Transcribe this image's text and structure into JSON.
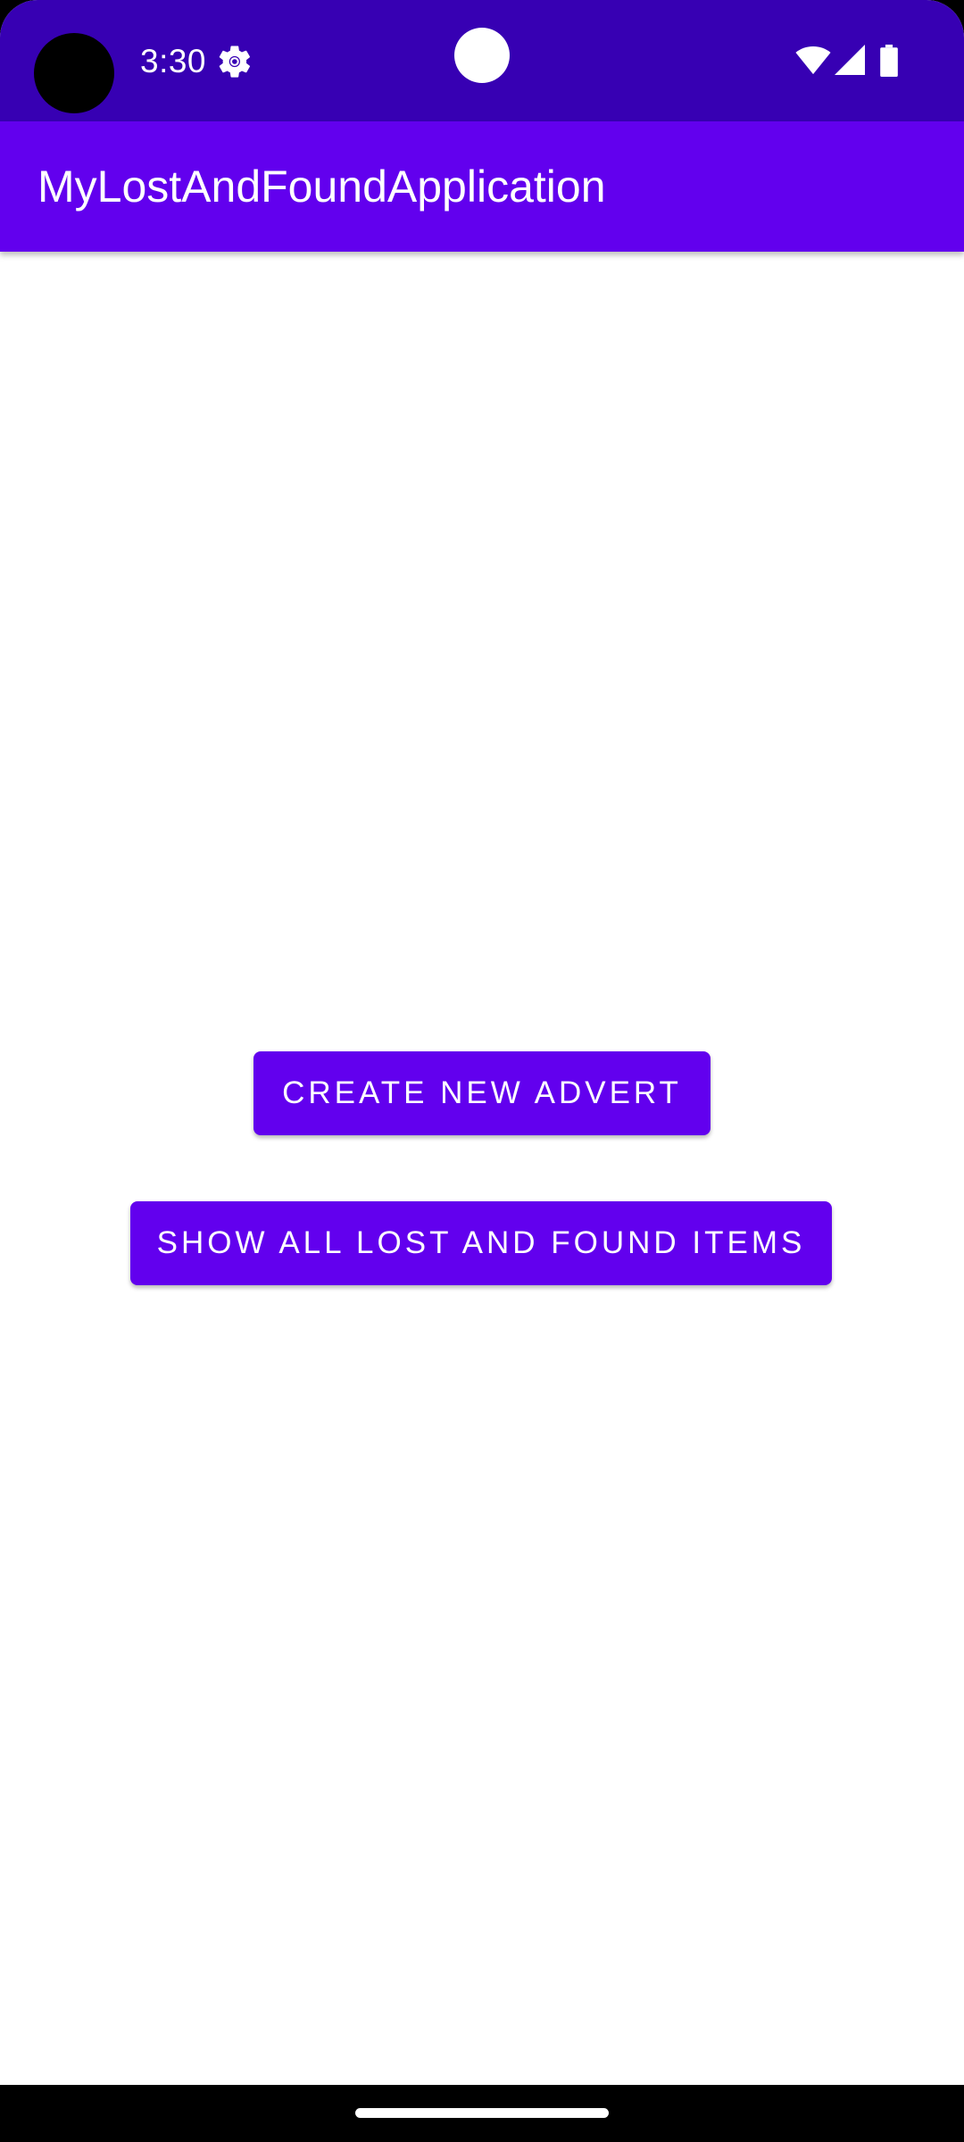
{
  "status_bar": {
    "time": "3:30",
    "icons": [
      "camera-cutout",
      "settings-icon",
      "notification-dot-icon",
      "wifi-icon",
      "cell-signal-icon",
      "battery-icon"
    ]
  },
  "app_bar": {
    "title": "MyLostAndFoundApplication"
  },
  "main": {
    "create_button_label": "CREATE NEW ADVERT",
    "show_button_label": "SHOW ALL LOST AND FOUND ITEMS"
  },
  "colors": {
    "status_bar": "#3700b3",
    "primary": "#6200ee",
    "background": "#ffffff"
  }
}
